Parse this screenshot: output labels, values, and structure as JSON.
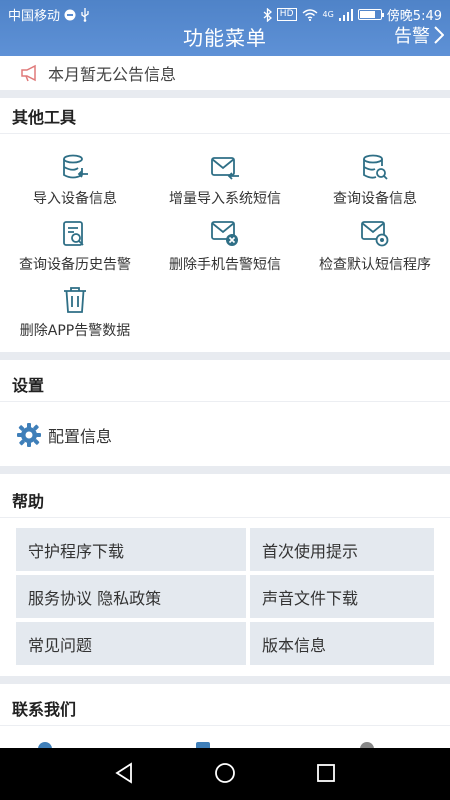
{
  "status_bar": {
    "carrier": "中国移动",
    "time": "傍晚5:49",
    "hd": "HD",
    "network": "4G"
  },
  "header": {
    "title": "功能菜单",
    "alarm_label": "告警"
  },
  "notice": {
    "text": "本月暂无公告信息"
  },
  "tools": {
    "title": "其他工具",
    "items": [
      {
        "label": "导入设备信息",
        "icon": "database-import-icon"
      },
      {
        "label": "增量导入系统短信",
        "icon": "mail-import-icon"
      },
      {
        "label": "查询设备信息",
        "icon": "database-search-icon"
      },
      {
        "label": "查询设备历史告警",
        "icon": "document-search-icon"
      },
      {
        "label": "删除手机告警短信",
        "icon": "mail-delete-icon"
      },
      {
        "label": "检查默认短信程序",
        "icon": "mail-settings-icon"
      },
      {
        "label": "删除APP告警数据",
        "icon": "trash-icon"
      }
    ]
  },
  "settings": {
    "title": "设置",
    "config_label": "配置信息"
  },
  "help": {
    "title": "帮助",
    "items": [
      "守护程序下载",
      "首次使用提示",
      "服务协议 隐私政策",
      "声音文件下载",
      "常见问题",
      "版本信息"
    ]
  },
  "contact": {
    "title": "联系我们"
  },
  "colors": {
    "header": "#5a8dd2",
    "accent": "#3f7fb9",
    "icon": "#2f6f86",
    "gap": "#e8ebf0",
    "help_bg": "#e4e9ef"
  }
}
